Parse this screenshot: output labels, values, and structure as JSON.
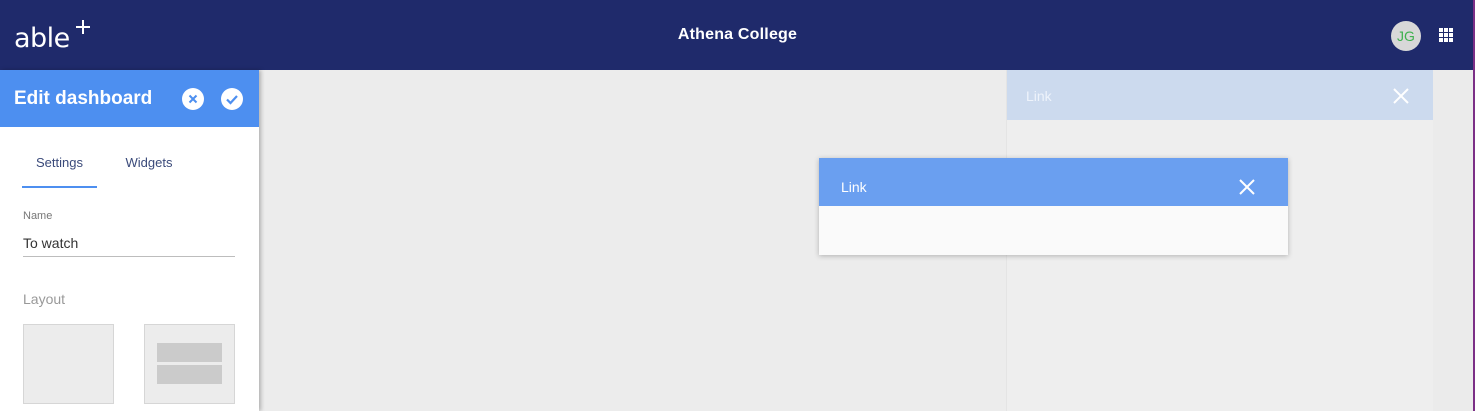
{
  "topbar": {
    "logo_text": "able",
    "app_title": "Athena College",
    "avatar_initials": "JG"
  },
  "sidebar": {
    "title": "Edit dashboard",
    "tabs": [
      {
        "label": "Settings",
        "active": true
      },
      {
        "label": "Widgets",
        "active": false
      }
    ],
    "name_field": {
      "label": "Name",
      "value": "To watch"
    },
    "layout": {
      "label": "Layout",
      "options": [
        "single-column",
        "two-row"
      ]
    }
  },
  "canvas": {
    "background_widget": {
      "title": "Link"
    },
    "dragging_widget": {
      "title": "Link"
    }
  },
  "colors": {
    "topbar": "#1f2a6b",
    "accent": "#4d8ff0",
    "avatar_text": "#3fb14f"
  },
  "icons": [
    "apps-grid-icon",
    "cancel-circle-icon",
    "check-circle-icon",
    "close-icon"
  ]
}
